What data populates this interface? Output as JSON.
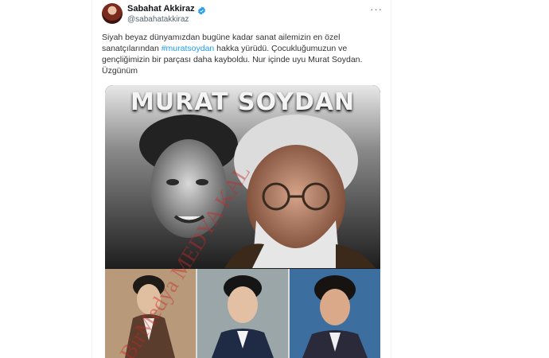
{
  "tweet": {
    "display_name": "Sabahat Akkiraz",
    "handle": "@sabahatakkiraz",
    "more_icon": "more-horizontal-icon",
    "verified_icon": "verified-badge-icon",
    "text_before_hashtag": "Siyah beyaz dünyamızdan bugüne kadar sanat ailemizin en özel sanatçılarından ",
    "hashtag": "#muratsoydan",
    "text_after_hashtag": " hakka yürüdü. Çocukluğumuzun ve gençliğimizin bir parçası daha kayboldu. Nur içinde uyu Murat Soydan. Üzgünüm"
  },
  "media": {
    "poster_title": "MURAT SOYDAN",
    "watermark": "BirMedya MEDYA KAL",
    "colors": {
      "accent": "#1d9bf0",
      "watermark": "#c82828"
    }
  }
}
